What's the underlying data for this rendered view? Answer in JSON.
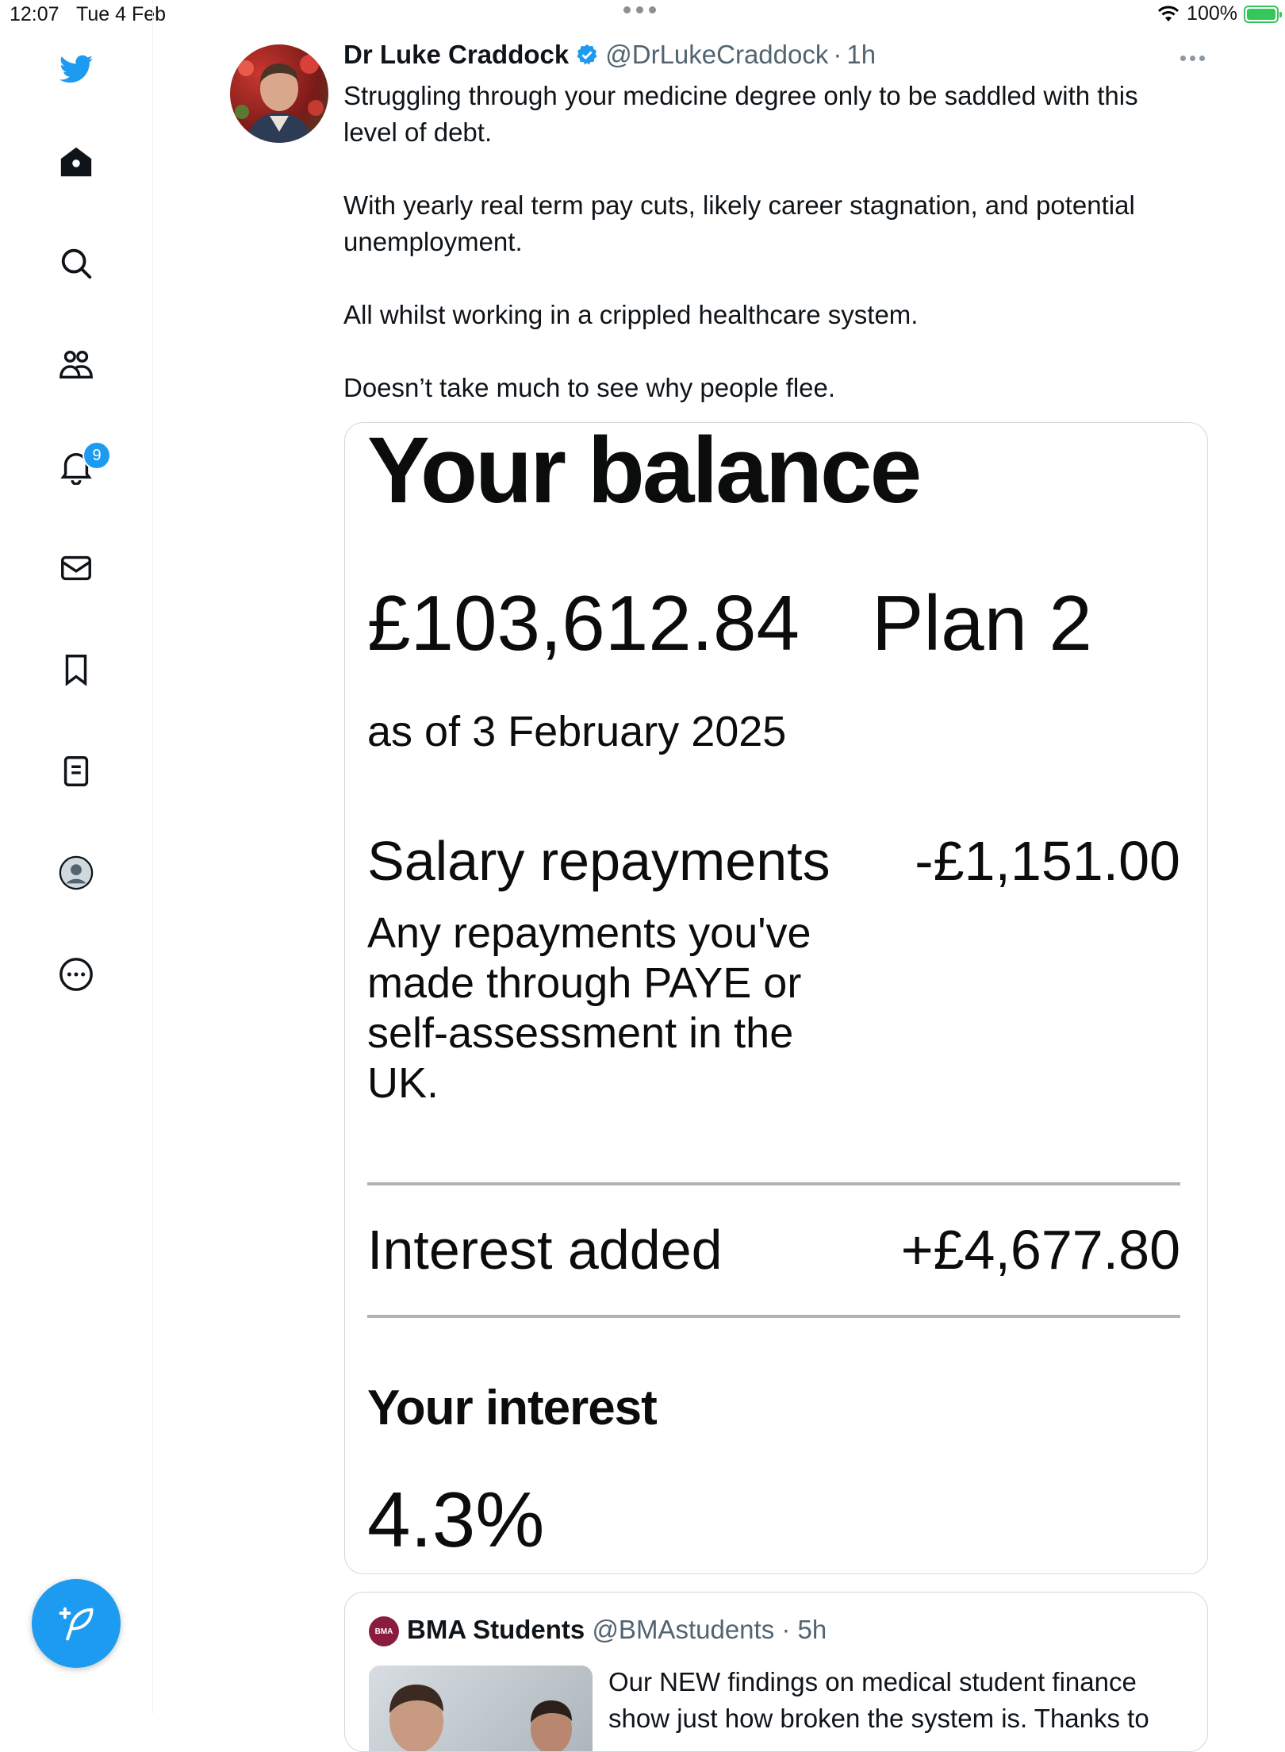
{
  "status_bar": {
    "time": "12:07",
    "date": "Tue 4 Feb",
    "battery": "100%"
  },
  "sidebar": {
    "items": [
      {
        "icon": "twitter-bird-icon"
      },
      {
        "icon": "home-icon"
      },
      {
        "icon": "search-icon"
      },
      {
        "icon": "communities-icon"
      },
      {
        "icon": "bell-icon"
      },
      {
        "icon": "mail-icon"
      },
      {
        "icon": "bookmark-icon"
      },
      {
        "icon": "lists-icon"
      },
      {
        "icon": "profile-icon"
      },
      {
        "icon": "more-circle-icon"
      }
    ],
    "notifications_badge": "9"
  },
  "tweet": {
    "author_name": "Dr Luke Craddock",
    "handle": "@DrLukeCraddock",
    "separator": "·",
    "time": "1h",
    "paragraphs": [
      "Struggling through your medicine degree only to be saddled with this level of debt.",
      "With yearly real term pay cuts, likely career stagnation, and potential unemployment.",
      "All whilst working in a crippled healthcare system.",
      "Doesn’t take much to see why people flee."
    ],
    "media": {
      "title": "Your balance",
      "amount": "£103,612.84",
      "plan": "Plan 2",
      "as_of": "as of 3 February 2025",
      "salary_label": "Salary repayments",
      "salary_value": "-£1,151.00",
      "salary_description": "Any repayments you've made through PAYE or self-assessment in the UK.",
      "interest_label": "Interest added",
      "interest_value": "+£4,677.80",
      "your_interest_label": "Your interest",
      "your_interest_value": "4.3%"
    }
  },
  "quoted": {
    "avatar_text": "BMA",
    "name": "BMA Students",
    "handle": "@BMAstudents",
    "separator": "·",
    "time": "5h",
    "text": "Our NEW findings on medical student finance show just how broken the system is. Thanks to"
  },
  "colors": {
    "accent": "#1d9bf0",
    "text": "#0f1419",
    "muted": "#536471"
  }
}
